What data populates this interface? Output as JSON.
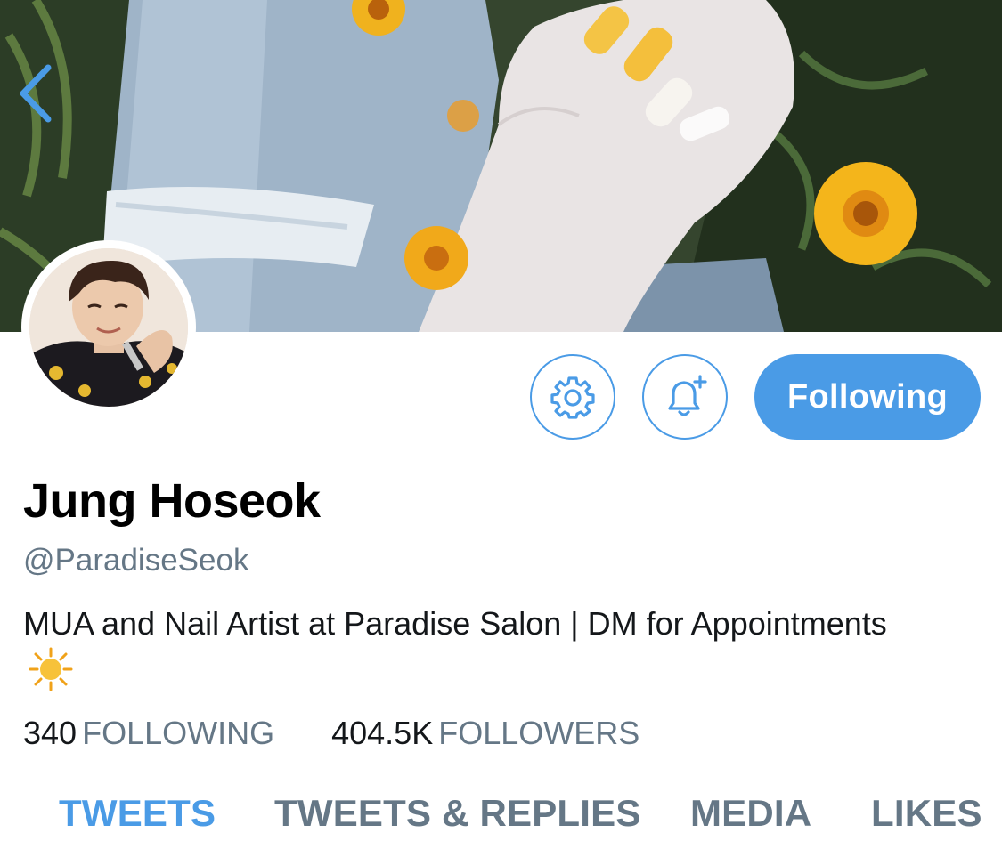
{
  "header": {
    "back_icon": "chevron-left-icon"
  },
  "actions": {
    "settings_icon": "gear-icon",
    "notifications_icon": "bell-plus-icon",
    "following_label": "Following"
  },
  "profile": {
    "name": "Jung Hoseok",
    "handle": "@ParadiseSeok",
    "bio": "MUA and Nail Artist at Paradise Salon | DM for Appointments",
    "bio_emoji": "sun-icon",
    "following_count": "340",
    "following_label": "FOLLOWING",
    "followers_count": "404.5K",
    "followers_label": "FOLLOWERS"
  },
  "tabs": [
    {
      "label": "TWEETS",
      "active": true
    },
    {
      "label": "TWEETS & REPLIES",
      "active": false
    },
    {
      "label": "MEDIA",
      "active": false
    },
    {
      "label": "LIKES",
      "active": false
    }
  ],
  "colors": {
    "accent": "#4a9be6",
    "secondary_text": "#657786",
    "primary_text": "#14171a"
  }
}
